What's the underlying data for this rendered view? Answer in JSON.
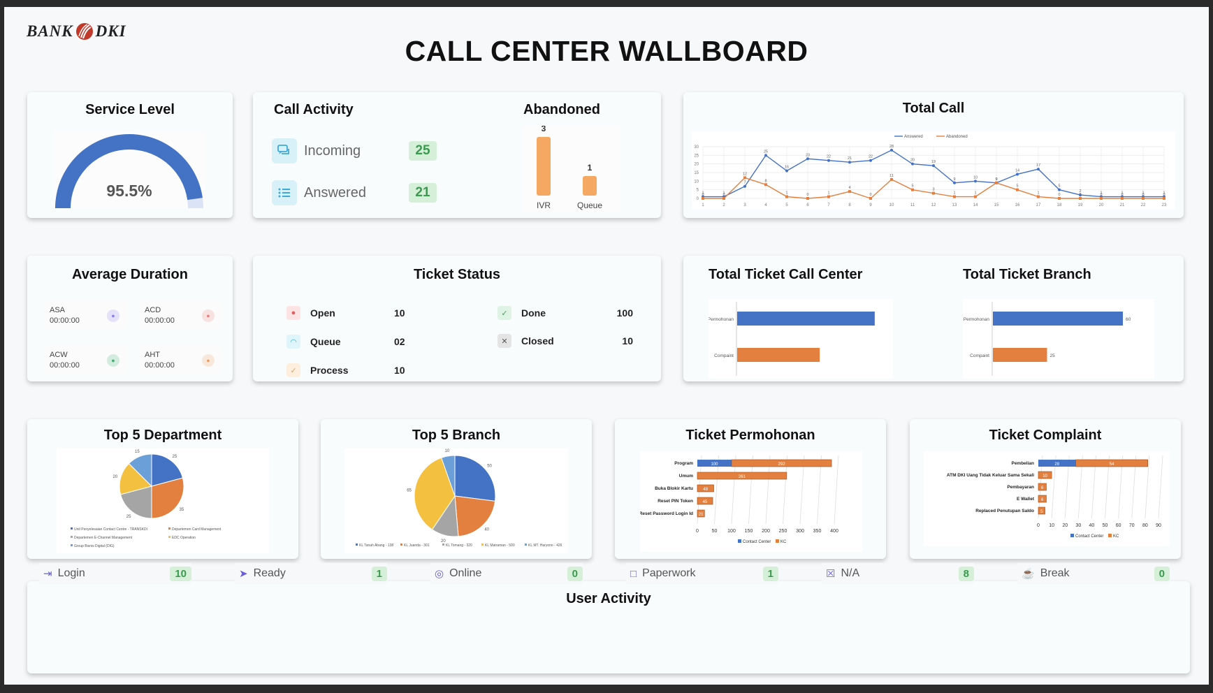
{
  "header": {
    "logo_left": "BANK",
    "logo_right": "DKI",
    "title": "CALL CENTER WALLBOARD"
  },
  "service_level": {
    "title": "Service Level",
    "value": "95.5%",
    "fraction": 0.955
  },
  "call_activity": {
    "title": "Call Activity",
    "items": [
      {
        "label": "Incoming",
        "value": "25"
      },
      {
        "label": "Answered",
        "value": "21"
      }
    ]
  },
  "abandoned": {
    "title": "Abandoned"
  },
  "total_call": {
    "title": "Total Call"
  },
  "average_duration": {
    "title": "Average Duration",
    "items": [
      {
        "label": "ASA",
        "value": "00:00:00",
        "icon": "hourglass-icon",
        "color": "#8d7ff0"
      },
      {
        "label": "ACD",
        "value": "00:00:00",
        "icon": "thumb-icon",
        "color": "#f07f7f"
      },
      {
        "label": "ACW",
        "value": "00:00:00",
        "icon": "list-icon",
        "color": "#3cb371"
      },
      {
        "label": "AHT",
        "value": "00:00:00",
        "icon": "calendar-icon",
        "color": "#f0a060"
      }
    ]
  },
  "ticket_status": {
    "title": "Ticket Status",
    "items": [
      {
        "label": "Open",
        "value": "10",
        "icon": "bell-icon",
        "bg": "#fde4e4",
        "fg": "#e06060"
      },
      {
        "label": "Queue",
        "value": "02",
        "icon": "spinner-icon",
        "bg": "#e0f4fb",
        "fg": "#40b0d8"
      },
      {
        "label": "Process",
        "value": "10",
        "icon": "check-icon",
        "bg": "#fdeedd",
        "fg": "#e8a060"
      },
      {
        "label": "Done",
        "value": "100",
        "icon": "check-circle-icon",
        "bg": "#dff3e4",
        "fg": "#3aa55a"
      },
      {
        "label": "Closed",
        "value": "10",
        "icon": "close-icon",
        "bg": "#e4e4e4",
        "fg": "#555"
      }
    ]
  },
  "total_ticket_cc": {
    "title": "Total Ticket Call Center"
  },
  "total_ticket_branch": {
    "title": "Total Ticket Branch"
  },
  "top5_department": {
    "title": "Top 5 Department"
  },
  "top5_branch": {
    "title": "Top 5 Branch"
  },
  "ticket_permohonan": {
    "title": "Ticket Permohonan"
  },
  "ticket_complaint": {
    "title": "Ticket Complaint"
  },
  "user_activity": {
    "title": "User Activity",
    "items": [
      {
        "label": "Login",
        "value": "10",
        "icon": "login-icon"
      },
      {
        "label": "Ready",
        "value": "1",
        "icon": "ready-icon"
      },
      {
        "label": "Online",
        "value": "0",
        "icon": "online-icon"
      },
      {
        "label": "Paperwork",
        "value": "1",
        "icon": "document-icon"
      },
      {
        "label": "N/A",
        "value": "8",
        "icon": "na-icon"
      },
      {
        "label": "Break",
        "value": "0",
        "icon": "cup-icon"
      }
    ]
  },
  "colors": {
    "blue": "#4472c4",
    "orange": "#e3803f",
    "gray": "#a5a5a5",
    "yellow": "#f4c040",
    "sky": "#6a9fd8",
    "abandoned_bar": "#f5a862"
  },
  "chart_data": [
    {
      "type": "bar",
      "title": "Abandoned",
      "categories": [
        "IVR",
        "Queue"
      ],
      "values": [
        3,
        1
      ]
    },
    {
      "type": "line",
      "title": "Total Call",
      "x": [
        1,
        2,
        3,
        4,
        5,
        6,
        7,
        8,
        9,
        10,
        11,
        12,
        13,
        14,
        15,
        16,
        17,
        18,
        19,
        20,
        21,
        22,
        23
      ],
      "ylim": [
        0,
        30
      ],
      "yticks": [
        0,
        5,
        10,
        15,
        20,
        25,
        30
      ],
      "series": [
        {
          "name": "Answered",
          "values": [
            1,
            1,
            7,
            25,
            16,
            23,
            22,
            21,
            22,
            28,
            20,
            19,
            9,
            10,
            9,
            14,
            17,
            5,
            2,
            1,
            1,
            1,
            1
          ]
        },
        {
          "name": "Abandoned",
          "values": [
            0,
            0,
            12,
            8,
            1,
            0,
            1,
            4,
            0,
            11,
            5,
            3,
            1,
            1,
            9,
            5,
            1,
            0,
            0,
            0,
            0,
            0,
            0
          ]
        }
      ]
    },
    {
      "type": "bar",
      "orientation": "horizontal",
      "title": "Total Ticket Call Center",
      "categories": [
        "Permohonan",
        "Compaint"
      ],
      "values": [
        75,
        45
      ]
    },
    {
      "type": "bar",
      "orientation": "horizontal",
      "title": "Total Ticket Branch",
      "categories": [
        "Permohonan",
        "Compaint"
      ],
      "values": [
        60,
        25
      ]
    },
    {
      "type": "pie",
      "title": "Top 5 Department",
      "labels": [
        "Unit Penyelesaian Contact Centre - TRANSKDI",
        "Departemen Card Management",
        "Departemen E-Channel Management",
        "EDC Operation",
        "Group Bisnis Digital (DIG)"
      ],
      "values": [
        25,
        35,
        25,
        20,
        15
      ]
    },
    {
      "type": "pie",
      "title": "Top 5 Branch",
      "labels": [
        "KL Tanah Abang - 138",
        "KL Juanda - 301",
        "KL Tomang - 320",
        "KL Matraman - 500",
        "KL MT. Haryono - 426"
      ],
      "values": [
        50,
        40,
        20,
        65,
        10
      ]
    },
    {
      "type": "bar",
      "orientation": "horizontal",
      "stacked": true,
      "title": "Ticket Permohonan",
      "categories": [
        "Program",
        "Umum",
        "Buka Blokir Kartu",
        "Reset PIN Token",
        "Reset Password Login Id"
      ],
      "series": [
        {
          "name": "Contact Center",
          "values": [
            100,
            0,
            0,
            0,
            0
          ]
        },
        {
          "name": "KC",
          "values": [
            292,
            261,
            48,
            45,
            21
          ]
        }
      ],
      "xlim": [
        0,
        400
      ],
      "xticks": [
        0,
        50,
        100,
        150,
        200,
        250,
        300,
        350,
        400
      ]
    },
    {
      "type": "bar",
      "orientation": "horizontal",
      "stacked": true,
      "title": "Ticket Complaint",
      "categories": [
        "Pembelian",
        "ATM DKI Uang Tidak Keluar Sama Sekali",
        "Pembayaran",
        "E Wallet",
        "Replaced Penutupan Saldo"
      ],
      "series": [
        {
          "name": "Contact Center",
          "values": [
            28,
            0,
            0,
            0,
            0
          ]
        },
        {
          "name": "KC",
          "values": [
            54,
            10,
            6,
            6,
            5
          ]
        }
      ],
      "xlim": [
        0,
        90
      ],
      "xticks": [
        0,
        10,
        20,
        30,
        40,
        50,
        60,
        70,
        80,
        90
      ]
    }
  ]
}
